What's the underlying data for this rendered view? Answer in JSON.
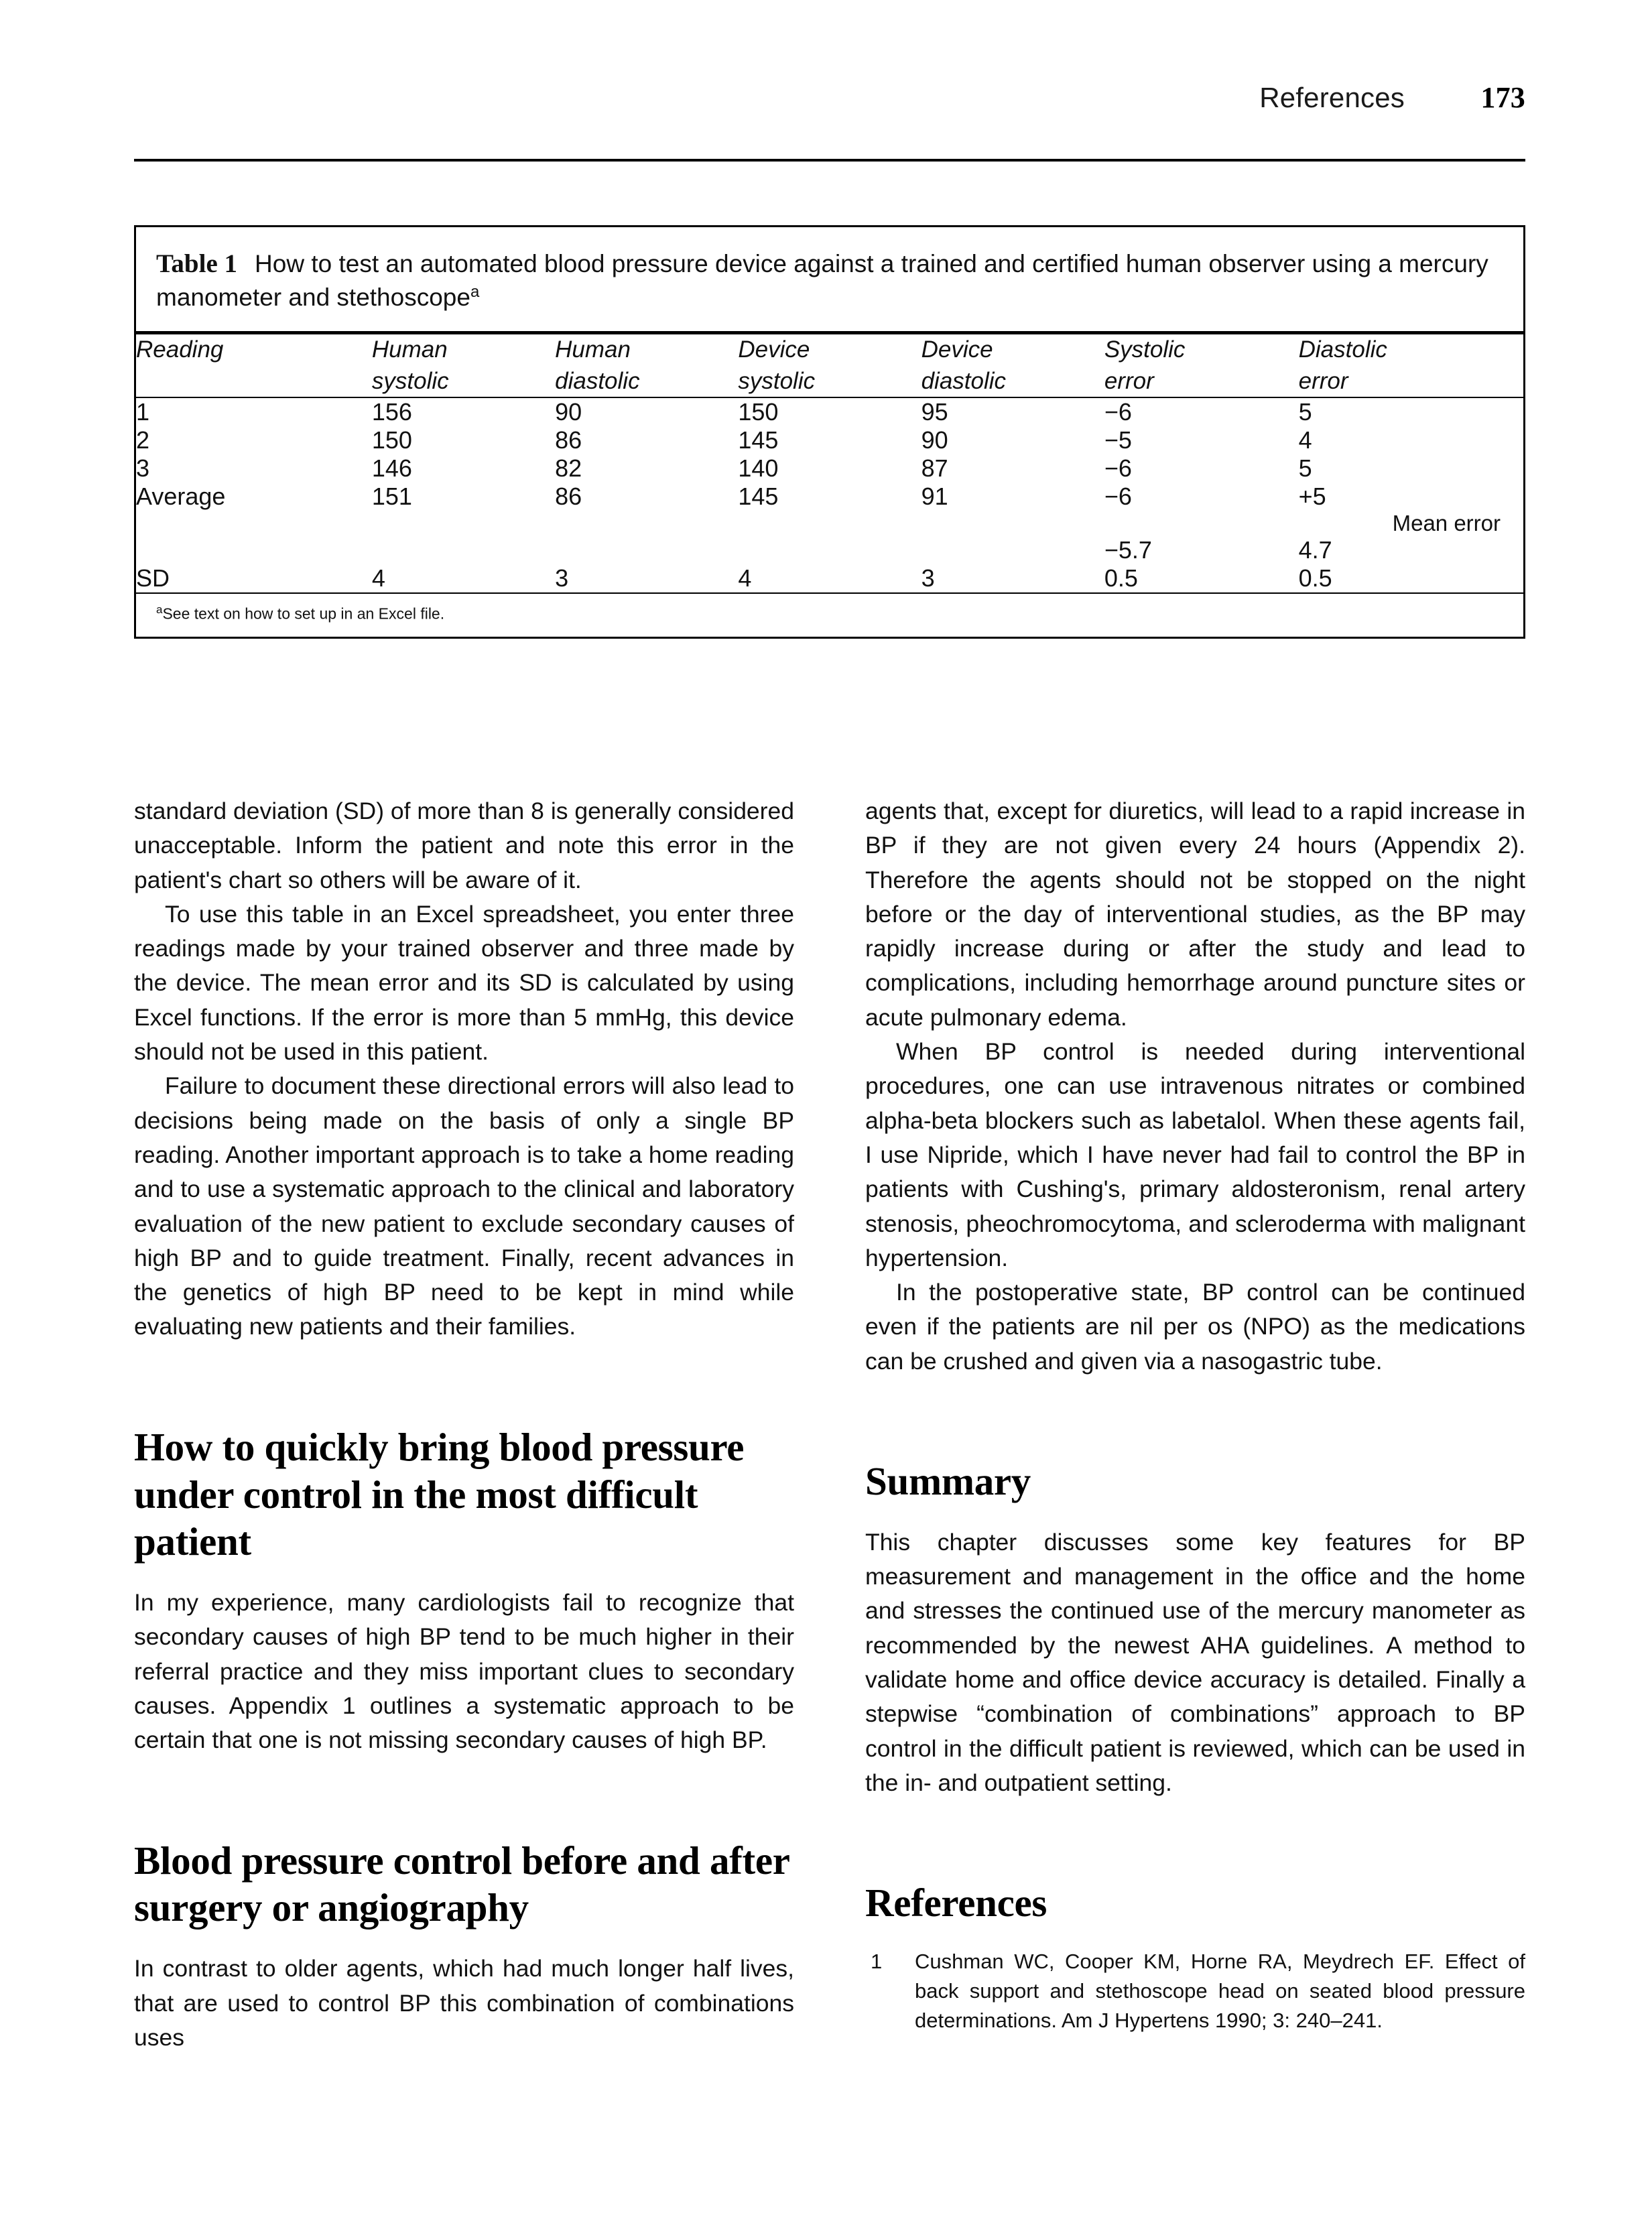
{
  "running_head": {
    "label": "References",
    "page_number": "173"
  },
  "table": {
    "caption_number": "Table 1",
    "caption_text": "How to test an automated blood pressure device against a trained and certified human observer using a mercury manometer and stethoscope",
    "caption_superscript": "a",
    "columns": [
      {
        "line1": "Reading",
        "line2": ""
      },
      {
        "line1": "Human",
        "line2": "systolic"
      },
      {
        "line1": "Human",
        "line2": "diastolic"
      },
      {
        "line1": "Device",
        "line2": "systolic"
      },
      {
        "line1": "Device",
        "line2": "diastolic"
      },
      {
        "line1": "Systolic",
        "line2": "error"
      },
      {
        "line1": "Diastolic",
        "line2": "error"
      }
    ],
    "rows": [
      [
        "1",
        "156",
        "90",
        "150",
        "95",
        "−6",
        "5"
      ],
      [
        "2",
        "150",
        "86",
        "145",
        "90",
        "−5",
        "4"
      ],
      [
        "3",
        "146",
        "82",
        "140",
        "87",
        "−6",
        "5"
      ],
      [
        "Average",
        "151",
        "86",
        "145",
        "91",
        "−6",
        "+5"
      ]
    ],
    "mean_error_label": "Mean error",
    "mean_error_values": {
      "systolic": "−5.7",
      "diastolic": "4.7"
    },
    "sd_row": [
      "SD",
      "4",
      "3",
      "4",
      "3",
      "0.5",
      "0.5"
    ],
    "footnote_marker": "a",
    "footnote_text": "See text on how to set up in an Excel file."
  },
  "left_column": {
    "paragraphs": [
      "standard deviation (SD) of more than 8 is generally considered unacceptable. Inform the patient and note this error in the patient's chart so others will be aware of it.",
      "To use this table in an Excel spreadsheet, you enter three readings made by your trained observer and three made by the device. The mean error and its SD is calculated by using Excel functions. If the error is more than 5 mmHg, this device should not be used in this patient.",
      "Failure to document these directional errors will also lead to decisions being made on the basis of only a single BP reading. Another important approach is to take a home reading and to use a systematic approach to the clinical and laboratory evaluation of the new patient to exclude secondary causes of high BP and to guide treatment. Finally, recent advances in the genetics of high BP need to be kept in mind while evaluating new patients and their families."
    ],
    "heading_1": "How to quickly bring blood pressure under control in the most difficult patient",
    "heading_1_body": "In my experience, many cardiologists fail to recognize that secondary causes of high BP tend to be much higher in their referral practice and they miss important clues to secondary causes. Appendix 1 outlines a systematic approach to be certain that one is not missing secondary causes of high BP.",
    "heading_2": "Blood pressure control before and after surgery or angiography",
    "heading_2_body": "In contrast to older agents, which had much longer half lives, that are used to control BP this combination of combinations uses"
  },
  "right_column": {
    "paragraphs": [
      "agents that, except for diuretics, will lead to a rapid increase in BP if they are not given every 24 hours (Appendix 2). Therefore the agents should not be stopped on the night before or the day of interventional studies, as the BP may rapidly increase during or after the study and lead to complications, including hemorrhage around puncture sites or acute pulmonary edema.",
      "When BP control is needed during interventional procedures, one can use intravenous nitrates or combined alpha-beta blockers such as labetalol. When these agents fail, I use Nipride, which I have never had fail to control the BP in patients with Cushing's, primary aldosteronism, renal artery stenosis, pheochromocytoma, and scleroderma with malignant hypertension.",
      "In the postoperative state, BP control can be continued even if the patients are nil per os (NPO) as the medications can be crushed and given via a nasogastric tube."
    ],
    "summary_heading": "Summary",
    "summary_body": "This chapter discusses some key features for BP measurement and management in the office and the home and stresses the continued use of the mercury manometer as recommended by the newest AHA guidelines. A method to validate home and office device accuracy is detailed. Finally a stepwise “combination of combinations” approach to BP control in the difficult patient is reviewed, which can be used in the in- and outpatient setting.",
    "references_heading": "References",
    "references": [
      {
        "number": "1",
        "text": "Cushman WC, Cooper KM, Horne RA, Meydrech EF. Effect of back support and stethoscope head on seated blood pressure determinations. Am J Hypertens 1990; 3: 240–241."
      }
    ]
  }
}
